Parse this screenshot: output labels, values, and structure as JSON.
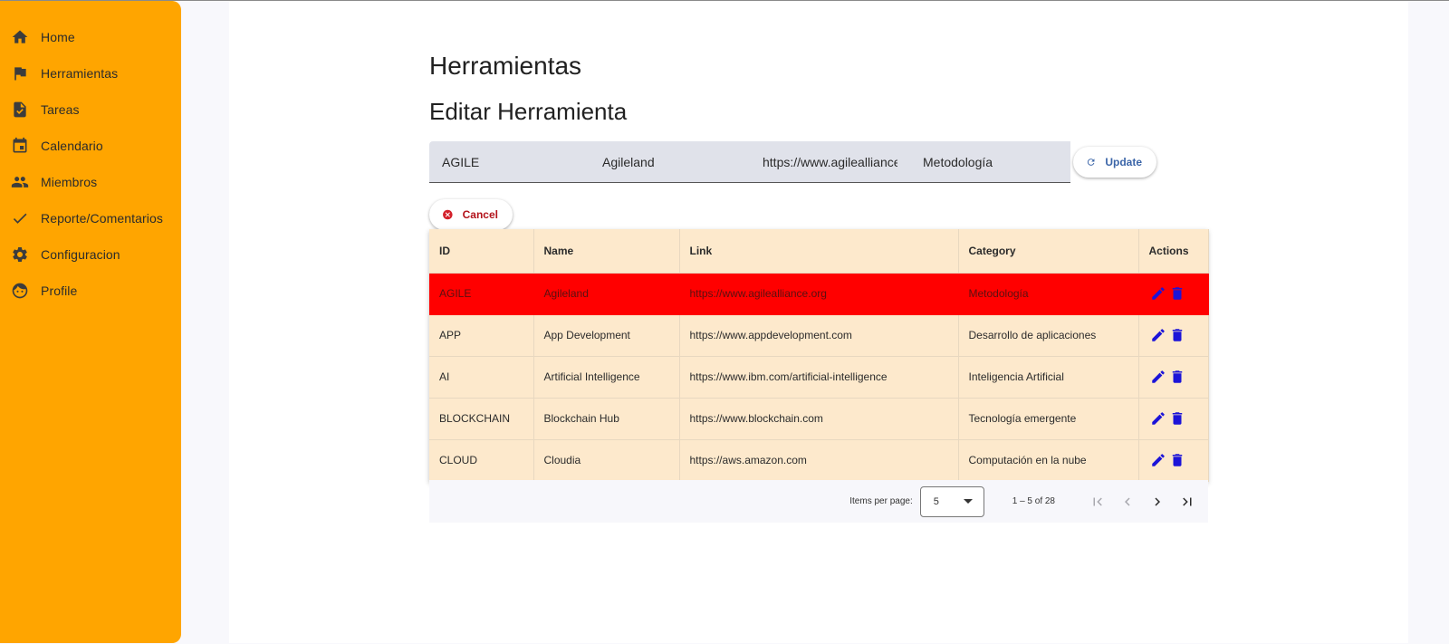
{
  "sidebar": {
    "items": [
      {
        "label": "Home",
        "icon": "home-icon"
      },
      {
        "label": "Herramientas",
        "icon": "flag-icon"
      },
      {
        "label": "Tareas",
        "icon": "task-icon"
      },
      {
        "label": "Calendario",
        "icon": "calendar-icon"
      },
      {
        "label": "Miembros",
        "icon": "people-icon"
      },
      {
        "label": "Reporte/Comentarios",
        "icon": "check-icon"
      },
      {
        "label": "Configuracion",
        "icon": "gear-icon"
      },
      {
        "label": "Profile",
        "icon": "face-icon"
      }
    ]
  },
  "page": {
    "title": "Herramientas",
    "subtitle": "Editar Herramienta"
  },
  "form": {
    "id_value": "AGILE",
    "name_value": "Agileland",
    "link_value": "https://www.agilealliance.org",
    "category_value": "Metodología",
    "update_label": "Update",
    "cancel_label": "Cancel"
  },
  "table": {
    "headers": [
      "ID",
      "Name",
      "Link",
      "Category",
      "Actions"
    ],
    "rows": [
      {
        "id": "AGILE",
        "name": "Agileland",
        "link": "https://www.agilealliance.org",
        "category": "Metodología",
        "selected": true
      },
      {
        "id": "APP",
        "name": "App Development",
        "link": "https://www.appdevelopment.com",
        "category": "Desarrollo de aplicaciones"
      },
      {
        "id": "AI",
        "name": "Artificial Intelligence",
        "link": "https://www.ibm.com/artificial-intelligence",
        "category": "Inteligencia Artificial"
      },
      {
        "id": "BLOCKCHAIN",
        "name": "Blockchain Hub",
        "link": "https://www.blockchain.com",
        "category": "Tecnología emergente"
      },
      {
        "id": "CLOUD",
        "name": "Cloudia",
        "link": "https://aws.amazon.com",
        "category": "Computación en la nube"
      }
    ]
  },
  "paginator": {
    "items_per_page_label": "Items per page:",
    "page_size": "5",
    "range_label": "1 – 5 of 28"
  },
  "colors": {
    "sidebar": "#ffa500",
    "row_bg": "#fde9cc",
    "selected_row": "#ff0000",
    "action_icons": "#1c14d8",
    "update_text": "#3b65a8",
    "cancel_text": "#b3131b"
  }
}
